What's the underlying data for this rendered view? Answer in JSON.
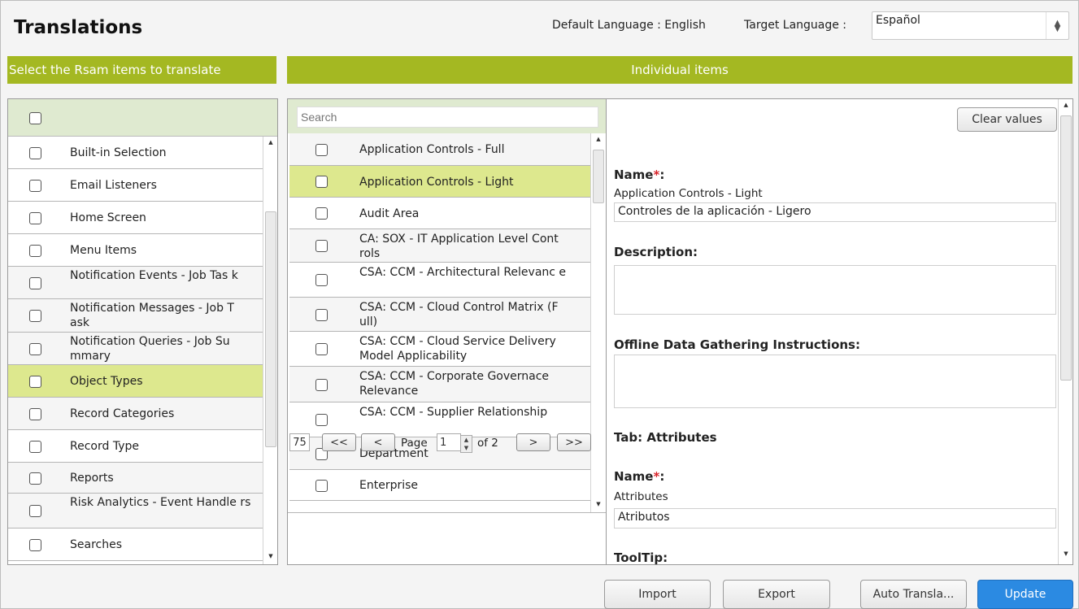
{
  "header": {
    "title": "Translations",
    "default_language": "Default Language : English",
    "target_language_label": "Target Language :",
    "target_language_value": "Español"
  },
  "bands": {
    "left": "Select the Rsam items to translate",
    "right": "Individual items"
  },
  "categories": [
    {
      "label": "Built-in Selection"
    },
    {
      "label": "Email Listeners"
    },
    {
      "label": "Home Screen"
    },
    {
      "label": "Menu Items"
    },
    {
      "label": "Notification Events - Job Tas k"
    },
    {
      "label": "Notification Messages - Job T ask"
    },
    {
      "label": "Notification Queries - Job Su mmary"
    },
    {
      "label": "Object Types"
    },
    {
      "label": "Record Categories"
    },
    {
      "label": "Record Type"
    },
    {
      "label": "Reports"
    },
    {
      "label": "Risk Analytics - Event Handle rs"
    },
    {
      "label": "Searches"
    }
  ],
  "items": {
    "search_placeholder": "Search",
    "list": [
      {
        "label": "Application Controls - Full"
      },
      {
        "label": "Application Controls - Light"
      },
      {
        "label": "Audit Area"
      },
      {
        "label": "CA: SOX - IT Application Level Cont rols"
      },
      {
        "label": "CSA: CCM - Architectural Relevanc e"
      },
      {
        "label": "CSA: CCM - Cloud Control Matrix (F ull)"
      },
      {
        "label": "CSA: CCM - Cloud Service Delivery Model Applicability"
      },
      {
        "label": "CSA: CCM - Corporate Governace Relevance"
      },
      {
        "label": "CSA: CCM - Supplier Relationship"
      },
      {
        "label": "Department"
      },
      {
        "label": "Enterprise"
      }
    ],
    "pager": {
      "page_size": "75",
      "first": "<<",
      "prev": "<",
      "page_label": "Page",
      "page_value": "1",
      "of_label": "of 2",
      "next": ">",
      "last": ">>"
    }
  },
  "detail": {
    "clear_label": "Clear values",
    "name_label": "Name",
    "required_mark": "*",
    "colon": ":",
    "name_default": "Application Controls - Light",
    "name_translation": "Controles de la aplicación - Ligero",
    "description_label": "Description:",
    "offline_label": "Offline Data Gathering Instructions:",
    "tab_label": "Tab: Attributes",
    "tab_name_label": "Name",
    "tab_name_default": "Attributes",
    "tab_name_translation": "Atributos",
    "tooltip_label": "ToolTip:"
  },
  "footer": {
    "import": "Import",
    "export": "Export",
    "auto_translate": "Auto Transla...",
    "update": "Update"
  },
  "colors": {
    "band": "#a4b822",
    "selected_row": "#dde88e",
    "header_row": "#dfead0",
    "primary_button": "#2b8ae2",
    "required": "#d8232a"
  }
}
